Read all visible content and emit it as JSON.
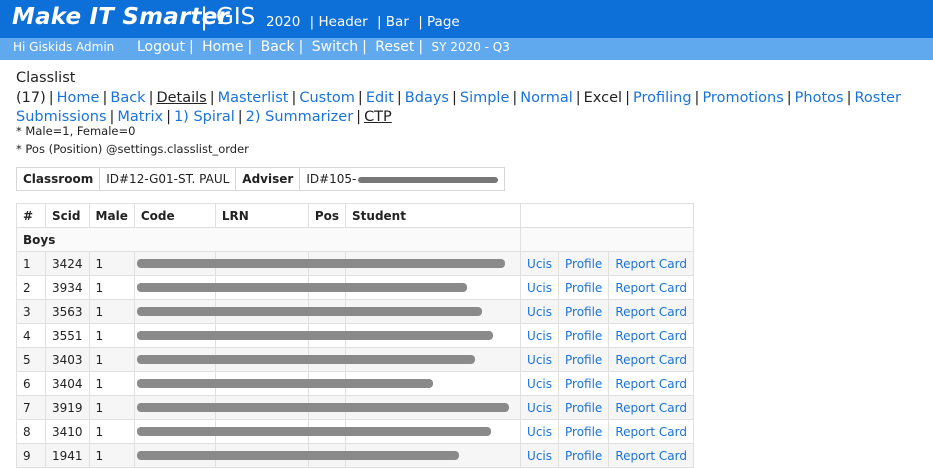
{
  "header": {
    "brand": "Make IT Smarter",
    "sep": "|",
    "gis": "GIS",
    "year": "2020",
    "nav": [
      "| Header",
      "| Bar",
      "| Page"
    ]
  },
  "subbar": {
    "greeting": "Hi Giskids Admin",
    "links": [
      "Logout",
      "|",
      "Home",
      "|",
      "Back",
      "|",
      "Switch",
      "|",
      "Reset",
      "|"
    ],
    "sy": "SY 2020 - Q3"
  },
  "menu": {
    "title": "Classlist (17)",
    "items": [
      {
        "label": "Home",
        "type": "link"
      },
      {
        "label": "Back",
        "type": "link"
      },
      {
        "label": "Details",
        "type": "current"
      },
      {
        "label": "Masterlist",
        "type": "link"
      },
      {
        "label": "Custom",
        "type": "link"
      },
      {
        "label": "Edit",
        "type": "link"
      },
      {
        "label": "Bdays",
        "type": "link"
      },
      {
        "label": "Simple",
        "type": "link"
      },
      {
        "label": "Normal",
        "type": "link"
      },
      {
        "label": "Excel",
        "type": "plain"
      },
      {
        "label": "Profiling",
        "type": "link"
      },
      {
        "label": "Promotions",
        "type": "link"
      },
      {
        "label": "Photos",
        "type": "link"
      },
      {
        "label": "Roster",
        "type": "link"
      },
      {
        "label": "Submissions",
        "type": "link"
      },
      {
        "label": "Matrix",
        "type": "link"
      },
      {
        "label": "1) Spiral",
        "type": "link"
      },
      {
        "label": "2) Summarizer",
        "type": "link"
      },
      {
        "label": "CTP",
        "type": "current"
      }
    ]
  },
  "notes": [
    "* Male=1, Female=0",
    "* Pos (Position) @settings.classlist_order"
  ],
  "info": {
    "classroom_label": "Classroom",
    "classroom_value": "ID#12-G01-ST. PAUL",
    "adviser_label": "Adviser",
    "adviser_value": "ID#105-"
  },
  "table": {
    "headers": [
      "#",
      "Scid",
      "Male",
      "Code",
      "LRN",
      "Pos",
      "Student",
      ""
    ],
    "group": "Boys",
    "action_labels": [
      "Ucis",
      "Profile",
      "Report Card"
    ],
    "rows": [
      {
        "n": "1",
        "scid": "3424",
        "male": "1"
      },
      {
        "n": "2",
        "scid": "3934",
        "male": "1"
      },
      {
        "n": "3",
        "scid": "3563",
        "male": "1"
      },
      {
        "n": "4",
        "scid": "3551",
        "male": "1"
      },
      {
        "n": "5",
        "scid": "3403",
        "male": "1"
      },
      {
        "n": "6",
        "scid": "3404",
        "male": "1"
      },
      {
        "n": "7",
        "scid": "3919",
        "male": "1"
      },
      {
        "n": "8",
        "scid": "3410",
        "male": "1"
      },
      {
        "n": "9",
        "scid": "1941",
        "male": "1"
      }
    ]
  }
}
